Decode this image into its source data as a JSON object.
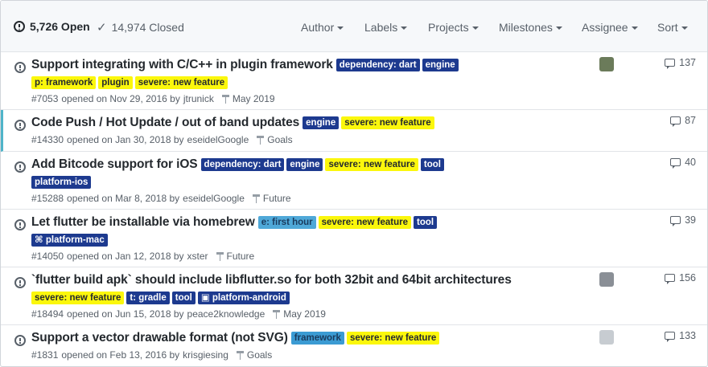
{
  "header": {
    "open_count": "5,726 Open",
    "closed_count": "14,974 Closed",
    "filters": [
      "Author",
      "Labels",
      "Projects",
      "Milestones",
      "Assignee",
      "Sort"
    ]
  },
  "issues": [
    {
      "title": "Support integrating with C/C++ in plugin framework",
      "title_labels": [
        {
          "text": "dependency: dart",
          "bg": "#1d3a8f",
          "fg": "#ffffff"
        },
        {
          "text": "engine",
          "bg": "#1d3a8f",
          "fg": "#ffffff"
        }
      ],
      "row_labels": [
        {
          "text": "p: framework",
          "bg": "#fbf70c",
          "fg": "#24292e"
        },
        {
          "text": "plugin",
          "bg": "#fbf70c",
          "fg": "#24292e"
        },
        {
          "text": "severe: new feature",
          "bg": "#fbf70c",
          "fg": "#24292e"
        }
      ],
      "number": "#7053",
      "opened": "opened on Nov 29, 2016 by",
      "author": "jtrunick",
      "milestone": "May 2019",
      "comments": "137",
      "has_avatar": true
    },
    {
      "title": "Code Push / Hot Update / out of band updates",
      "title_labels": [
        {
          "text": "engine",
          "bg": "#1d3a8f",
          "fg": "#ffffff"
        },
        {
          "text": "severe: new feature",
          "bg": "#fbf70c",
          "fg": "#24292e"
        }
      ],
      "row_labels": [],
      "number": "#14330",
      "opened": "opened on Jan 30, 2018 by",
      "author": "eseidelGoogle",
      "milestone": "Goals",
      "comments": "87",
      "has_avatar": false
    },
    {
      "title": "Add Bitcode support for iOS",
      "title_labels": [
        {
          "text": "dependency: dart",
          "bg": "#1d3a8f",
          "fg": "#ffffff"
        },
        {
          "text": "engine",
          "bg": "#1d3a8f",
          "fg": "#ffffff"
        },
        {
          "text": "severe: new feature",
          "bg": "#fbf70c",
          "fg": "#24292e"
        },
        {
          "text": "tool",
          "bg": "#1d3a8f",
          "fg": "#ffffff"
        }
      ],
      "row_labels": [
        {
          "text": " platform-ios",
          "bg": "#1d3a8f",
          "fg": "#ffffff"
        }
      ],
      "number": "#15288",
      "opened": "opened on Mar 8, 2018 by",
      "author": "eseidelGoogle",
      "milestone": "Future",
      "comments": "40",
      "has_avatar": false
    },
    {
      "title": "Let flutter be installable via homebrew",
      "title_labels": [
        {
          "text": "e: first hour",
          "bg": "#4fa8d8",
          "fg": "#1a3a5c"
        },
        {
          "text": "severe: new feature",
          "bg": "#fbf70c",
          "fg": "#24292e"
        },
        {
          "text": "tool",
          "bg": "#1d3a8f",
          "fg": "#ffffff"
        }
      ],
      "row_labels": [
        {
          "text": "⌘ platform-mac",
          "bg": "#1d3a8f",
          "fg": "#ffffff"
        }
      ],
      "number": "#14050",
      "opened": "opened on Jan 12, 2018 by",
      "author": "xster",
      "milestone": "Future",
      "comments": "39",
      "has_avatar": false
    },
    {
      "title": "`flutter build apk` should include libflutter.so for both 32bit and 64bit architectures",
      "title_labels": [],
      "row_labels": [
        {
          "text": "severe: new feature",
          "bg": "#fbf70c",
          "fg": "#24292e"
        },
        {
          "text": "t: gradle",
          "bg": "#1d3a8f",
          "fg": "#ffffff"
        },
        {
          "text": "tool",
          "bg": "#1d3a8f",
          "fg": "#ffffff"
        },
        {
          "text": "▣ platform-android",
          "bg": "#1d3a8f",
          "fg": "#ffffff"
        }
      ],
      "number": "#18494",
      "opened": "opened on Jun 15, 2018 by",
      "author": "peace2knowledge",
      "milestone": "May 2019",
      "comments": "156",
      "has_avatar": true
    },
    {
      "title": "Support a vector drawable format (not SVG)",
      "title_labels": [
        {
          "text": "framework",
          "bg": "#3b9bd3",
          "fg": "#1a3a5c"
        },
        {
          "text": "severe: new feature",
          "bg": "#fbf70c",
          "fg": "#24292e"
        }
      ],
      "row_labels": [],
      "number": "#1831",
      "opened": "opened on Feb 13, 2016 by",
      "author": "krisgiesing",
      "milestone": "Goals",
      "comments": "133",
      "has_avatar": true
    }
  ]
}
